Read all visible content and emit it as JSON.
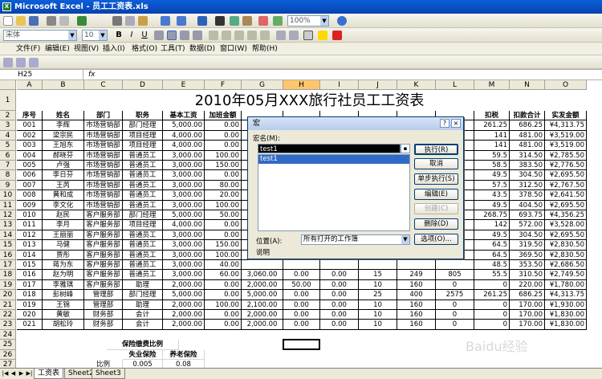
{
  "window": {
    "title": "Microsoft Excel - 员工工资表.xls"
  },
  "toolbar": {
    "zoom": "100%",
    "font": "宋体",
    "size": "10"
  },
  "menu": [
    "文件(F)",
    "编辑(E)",
    "视图(V)",
    "插入(I)",
    "格式(O)",
    "工具(T)",
    "数据(D)",
    "窗口(W)",
    "帮助(H)"
  ],
  "formula_bar": {
    "namebox": "H25",
    "fx": "fx",
    "value": ""
  },
  "columns": [
    "A",
    "B",
    "C",
    "D",
    "E",
    "F",
    "G",
    "H",
    "I",
    "J",
    "K",
    "L",
    "M",
    "N",
    "O"
  ],
  "selected_column": "H",
  "sheet": {
    "title": "2010年05月XXX旅行社员工工资表",
    "headers": [
      "序号",
      "姓名",
      "部门",
      "职务",
      "基本工资",
      "加班金额",
      "",
      "",
      "",
      "",
      "",
      "",
      "扣税",
      "扣款合计",
      "实发金额"
    ],
    "rows": [
      [
        "001",
        "李辉",
        "市场营销部",
        "部门经理",
        "5,000.00",
        "0.00",
        "",
        "",
        "",
        "",
        "",
        "",
        "261.25",
        "686.25",
        "¥4,313.75"
      ],
      [
        "002",
        "梁宗民",
        "市场营销部",
        "项目经理",
        "4,000.00",
        "0.00",
        "",
        "",
        "",
        "",
        "",
        "",
        "141",
        "481.00",
        "¥3,519.00"
      ],
      [
        "003",
        "王旭东",
        "市场营销部",
        "项目经理",
        "4,000.00",
        "0.00",
        "",
        "",
        "",
        "",
        "",
        "",
        "141",
        "481.00",
        "¥3,519.00"
      ],
      [
        "004",
        "郝晓芬",
        "市场营销部",
        "普通员工",
        "3,000.00",
        "100.00",
        "",
        "",
        "",
        "",
        "",
        "",
        "59.5",
        "314.50",
        "¥2,785.50"
      ],
      [
        "005",
        "卢强",
        "市场营销部",
        "普通员工",
        "3,000.00",
        "150.00",
        "",
        "",
        "",
        "",
        "",
        "",
        "58.5",
        "383.50",
        "¥2,776.50"
      ],
      [
        "006",
        "李日芬",
        "市场营销部",
        "普通员工",
        "3,000.00",
        "0.00",
        "",
        "",
        "",
        "",
        "",
        "",
        "49.5",
        "304.50",
        "¥2,695.50"
      ],
      [
        "007",
        "王芮",
        "市场营销部",
        "普通员工",
        "3,000.00",
        "80.00",
        "",
        "",
        "",
        "",
        "",
        "",
        "57.5",
        "312.50",
        "¥2,767.50"
      ],
      [
        "008",
        "黄和成",
        "市场营销部",
        "普通员工",
        "3,000.00",
        "20.00",
        "",
        "",
        "",
        "",
        "",
        "",
        "43.5",
        "378.50",
        "¥2,641.50"
      ],
      [
        "009",
        "李文化",
        "市场营销部",
        "普通员工",
        "3,000.00",
        "100.00",
        "",
        "",
        "",
        "",
        "",
        "",
        "49.5",
        "404.50",
        "¥2,695.50"
      ],
      [
        "010",
        "赵民",
        "客户服务部",
        "部门经理",
        "5,000.00",
        "50.00",
        "",
        "",
        "",
        "",
        "",
        "",
        "268.75",
        "693.75",
        "¥4,356.25"
      ],
      [
        "011",
        "李月",
        "客户服务部",
        "项目经理",
        "4,000.00",
        "0.00",
        "",
        "",
        "",
        "",
        "",
        "",
        "142",
        "572.00",
        "¥3,528.00"
      ],
      [
        "012",
        "王丽丽",
        "客户服务部",
        "普通员工",
        "3,000.00",
        "0.00",
        "",
        "",
        "",
        "",
        "",
        "",
        "49.5",
        "304.50",
        "¥2,695.50"
      ],
      [
        "013",
        "马健",
        "客户服务部",
        "普通员工",
        "3,000.00",
        "150.00",
        "",
        "",
        "",
        "",
        "",
        "",
        "64.5",
        "319.50",
        "¥2,830.50"
      ],
      [
        "014",
        "贾彤",
        "客户服务部",
        "普通员工",
        "3,000.00",
        "100.00",
        "",
        "",
        "",
        "",
        "",
        "",
        "64.5",
        "369.50",
        "¥2,830.50"
      ],
      [
        "015",
        "蒋为东",
        "客户服务部",
        "普通员工",
        "3,000.00",
        "40.00",
        "",
        "",
        "",
        "",
        "",
        "",
        "48.5",
        "353.50",
        "¥2,686.50"
      ],
      [
        "016",
        "赵为明",
        "客户服务部",
        "普通员工",
        "3,000.00",
        "60.00",
        "3,060.00",
        "0.00",
        "0.00",
        "15",
        "249",
        "805",
        "55.5",
        "310.50",
        "¥2,749.50"
      ],
      [
        "017",
        "李雅琪",
        "客户服务部",
        "助理",
        "2,000.00",
        "0.00",
        "2,000.00",
        "50.00",
        "0.00",
        "10",
        "160",
        "0",
        "0",
        "220.00",
        "¥1,780.00"
      ],
      [
        "018",
        "彭树峰",
        "管理部",
        "部门经理",
        "5,000.00",
        "0.00",
        "5,000.00",
        "0.00",
        "0.00",
        "25",
        "400",
        "2575",
        "261.25",
        "686.25",
        "¥4,313.75"
      ],
      [
        "019",
        "王锦",
        "管理部",
        "助理",
        "2,000.00",
        "100.00",
        "2,100.00",
        "0.00",
        "0.00",
        "10",
        "160",
        "0",
        "0",
        "170.00",
        "¥1,930.00"
      ],
      [
        "020",
        "黄敏",
        "财务部",
        "会计",
        "2,000.00",
        "0.00",
        "2,000.00",
        "0.00",
        "0.00",
        "10",
        "160",
        "0",
        "0",
        "170.00",
        "¥1,830.00"
      ],
      [
        "021",
        "胡松玲",
        "财务部",
        "会计",
        "2,000.00",
        "0.00",
        "2,000.00",
        "0.00",
        "0.00",
        "10",
        "160",
        "0",
        "0",
        "170.00",
        "¥1,830.00"
      ]
    ],
    "insurance": {
      "title": "保险缴费比例",
      "col1": "失业保险",
      "col2": "养老保险",
      "row_label": "比例",
      "v1": "0.005",
      "v2": "0.08"
    }
  },
  "dialog": {
    "title": "宏",
    "name_label": "宏名(M):",
    "name_value": "test1",
    "list_item": "test1",
    "location_label": "位置(A):",
    "location_value": "所有打开的工作簿",
    "desc_label": "说明",
    "buttons": [
      "执行(R)",
      "取消",
      "单步执行(S)",
      "编辑(E)",
      "创建(C)",
      "删除(D)",
      "选项(O)..."
    ]
  },
  "tabs": [
    "工资表",
    "Sheet2",
    "Sheet3"
  ],
  "watermark": "Baidu经验"
}
